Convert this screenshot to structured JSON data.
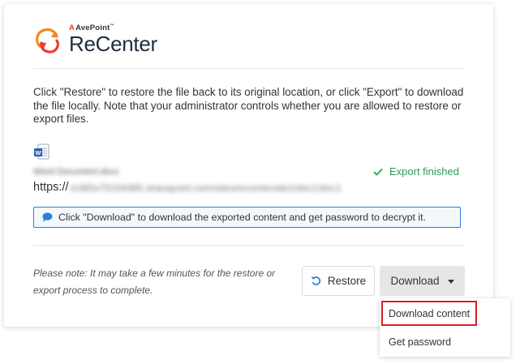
{
  "brand": {
    "company": "AvePoint",
    "product": "ReCenter",
    "accent_color": "#e8402a"
  },
  "description": "Click \"Restore\" to restore the file back to its original location, or click \"Export\" to download the file locally. Note that your administrator controls whether you are allowed to restore or export files.",
  "file": {
    "icon": "word-document-icon",
    "name": "Word Document.docx",
    "url_prefix": "https://",
    "url_rest": "m365x75154365.sharepoint.com/sites/recentersite1/doc1/doc1",
    "status": "Export finished",
    "status_color": "#2a9d54"
  },
  "info_message": "Click \"Download\" to download the exported content and get password to decrypt it.",
  "note": "Please note: It may take a few minutes for the restore or export process to complete.",
  "buttons": {
    "restore": "Restore",
    "download": "Download"
  },
  "download_menu": {
    "items": [
      {
        "label": "Download content"
      },
      {
        "label": "Get password"
      }
    ]
  }
}
